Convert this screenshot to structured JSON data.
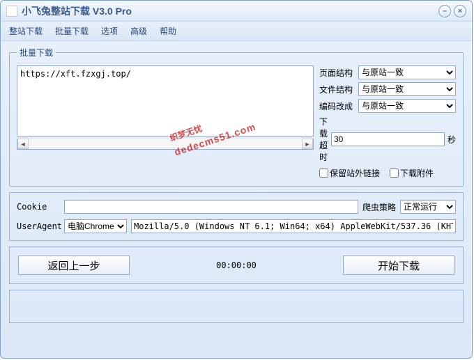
{
  "window": {
    "title": "小飞兔整站下载 V3.0 Pro"
  },
  "menu": {
    "site": "整站下载",
    "batch": "批量下载",
    "options": "选项",
    "advanced": "高级",
    "help": "帮助"
  },
  "group_title": "批量下载",
  "url_text": "https://xft.fzxgj.top/",
  "opts": {
    "page_struct_label": "页面结构",
    "page_struct_value": "与原站一致",
    "file_struct_label": "文件结构",
    "file_struct_value": "与原站一致",
    "encoding_label": "编码改成",
    "encoding_value": "与原站一致",
    "timeout_label": "下载超时",
    "timeout_value": "30",
    "timeout_unit": "秒",
    "keep_ext_links": "保留站外链接",
    "download_attach": "下载附件"
  },
  "cookie_label": "Cookie",
  "cookie_value": "",
  "crawl_policy_label": "爬虫策略",
  "crawl_policy_value": "正常运行",
  "ua_label": "UserAgent",
  "ua_preset": "电脑Chrome",
  "ua_value": "Mozilla/5.0 (Windows NT 6.1; Win64; x64) AppleWebKit/537.36 (KHTML, ",
  "back_btn": "返回上一步",
  "timer": "00:00:00",
  "start_btn": "开始下载",
  "watermark_main": "织梦无忧",
  "watermark_sub": "dedecms51.com"
}
